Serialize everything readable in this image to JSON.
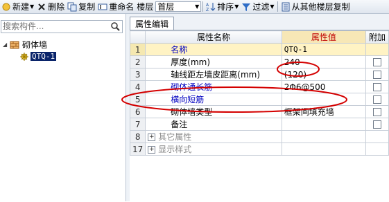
{
  "toolbar": {
    "new_label": "新建",
    "delete_label": "删除",
    "copy_label": "复制",
    "rename_label": "重命名",
    "floor_label": "楼层",
    "floor_value": "首层",
    "sort_label": "排序",
    "filter_label": "过滤",
    "copy_from_label": "从其他楼层复制"
  },
  "left": {
    "search_placeholder": "搜索构件...",
    "tree": {
      "root_label": "砌体墙",
      "child_label": "QTQ-1"
    }
  },
  "tab": {
    "label": "属性编辑"
  },
  "grid": {
    "headers": {
      "name": "属性名称",
      "value": "属性值",
      "extra": "附加"
    },
    "rows": [
      {
        "num": "1",
        "name": "名称",
        "value": "QTQ-1"
      },
      {
        "num": "2",
        "name": "厚度(mm)",
        "value": "240"
      },
      {
        "num": "3",
        "name": "轴线距左墙皮距离(mm)",
        "value": "(120)"
      },
      {
        "num": "4",
        "name": "砌体通长筋",
        "value": "2Φ6@500"
      },
      {
        "num": "5",
        "name": "横向短筋",
        "value": ""
      },
      {
        "num": "6",
        "name": "砌体墙类型",
        "value": "框架间填充墙"
      },
      {
        "num": "7",
        "name": "备注",
        "value": ""
      },
      {
        "num": "8",
        "name": "其它属性",
        "value": ""
      },
      {
        "num": "17",
        "name": "显示样式",
        "value": ""
      }
    ]
  },
  "colors": {
    "annotation": "#d40000",
    "selection": "#0a246a",
    "value_header": "#f7e7b6"
  }
}
